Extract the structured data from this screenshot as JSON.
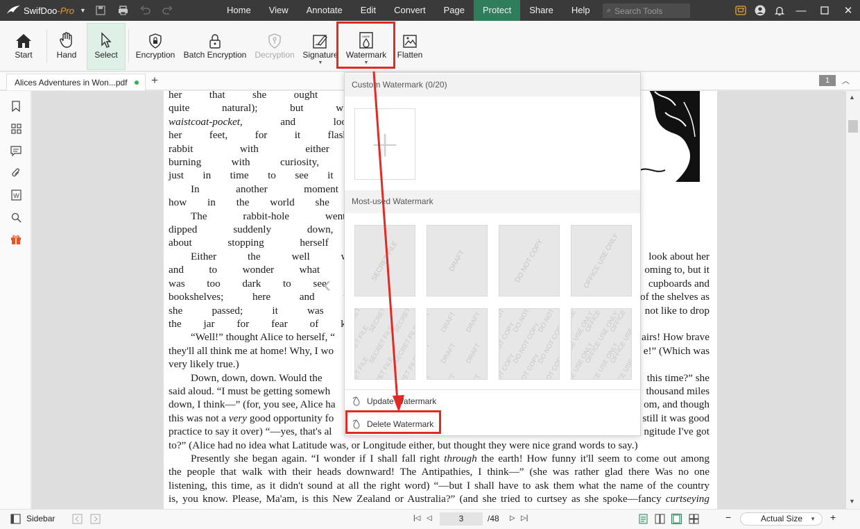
{
  "app": {
    "name": "SwifDoo",
    "edition": "-Pro"
  },
  "menu": [
    "Home",
    "View",
    "Annotate",
    "Edit",
    "Convert",
    "Page",
    "Protect",
    "Share",
    "Help"
  ],
  "active_menu": "Protect",
  "search": {
    "placeholder": "Search Tools"
  },
  "ribbon": {
    "start": "Start",
    "hand": "Hand",
    "select": "Select",
    "encryption": "Encryption",
    "batch_encryption": "Batch Encryption",
    "decryption": "Decryption",
    "signature": "Signature",
    "watermark": "Watermark",
    "flatten": "Flatten"
  },
  "tab": {
    "title": "Alices Adventures in Won...pdf"
  },
  "page_badge": "1",
  "document_text": {
    "lines": [
      [
        "her that she ought to have wondered a",
        false,
        false
      ],
      [
        "quite natural); but when the Rabbit a",
        false,
        false
      ],
      [
        "waistcoat-pocket, and looked at it, an",
        false,
        false
      ],
      [
        "her feet, for it flashed across her mind",
        false,
        false
      ],
      [
        "rabbit with either a waistcoat-pocket,",
        false,
        false
      ],
      [
        "burning with curiosity, she ran across th",
        false,
        false
      ],
      [
        "just in time to see it pop down a large ra",
        false,
        false
      ],
      [
        "In another moment down went Al",
        true,
        false
      ],
      [
        "how in the world she was to get out agai",
        false,
        false
      ],
      [
        "The rabbit-hole went straight on li",
        true,
        false
      ],
      [
        "dipped suddenly down, so suddenly tha",
        false,
        false
      ],
      [
        "about stopping herself before she found",
        false,
        false
      ]
    ],
    "para_rest": [
      "Either the well was very deep, or s",
      "and to wonder what was going to happe",
      "was too dark to see anything; then she lo",
      "bookshelves; here and there she saw ma",
      "she passed; it was labelled “Orange Ma",
      "the jar for fear of killing somebody, so n"
    ],
    "right_frag": [
      "look about her",
      "oming to, but it",
      "cupboards and",
      "of the shelves as",
      "not like to drop"
    ],
    "well1": "“Well!” thought Alice to herself, “",
    "well1_right": "airs! How brave",
    "well2": "they'll all think me at home! Why, I wo",
    "well2_right": "e!” (Which was",
    "well3": "very likely true.)",
    "down1": "Down, down, down. Would the",
    "down1_right": "this time?” she",
    "down2": "said aloud. “I must be getting somewh",
    "down2_right": "thousand miles",
    "down3": "down, I think—” (for, you see, Alice ha",
    "down3_right": "om, and though",
    "down4a": "this was not a ",
    "down4b": "very",
    "down4c": " good opportunity fo",
    "down4_right": "still it was good",
    "down5": "practice to say it over) “—yes, that's al",
    "down5_right": "ngitude I've got",
    "down6": "to?” (Alice had no idea what Latitude was, or Longitude either, but thought they were nice grand words to say.)",
    "pres1a": "Presently she began again. “I wonder if I shall fall right ",
    "pres1b": "through",
    "pres1c": " the earth! How funny it'll seem to come out among",
    "pres2": "the people that walk with their heads downward! The Antipathies, I think—” (she was rather glad there Was no one",
    "pres3": "listening, this time, as it didn't sound at all the right word) “—but I shall have to ask them what the name of the country",
    "pres4a": "is, you know. Please, Ma'am, is this New Zealand or Australia?” (and she tried to curtsey as she spoke—fancy ",
    "pres4b": "curtseying"
  },
  "watermark_menu": {
    "custom_header": "Custom Watermark (0/20)",
    "most_used_header": "Most-used Watermark",
    "presets": [
      "SECRET FILE",
      "DRAFT",
      "DO NOT COPY",
      "OFFICE USE ONLY"
    ],
    "update_label": "Update Watermark",
    "delete_label": "Delete Watermark"
  },
  "status": {
    "sidebar": "Sidebar",
    "current_page": "3",
    "total_pages": "/48",
    "zoom": "Actual Size"
  },
  "colors": {
    "titlebar": "#3a3a3a",
    "accent": "#2f7d5b",
    "highlight": "#e22a25"
  }
}
